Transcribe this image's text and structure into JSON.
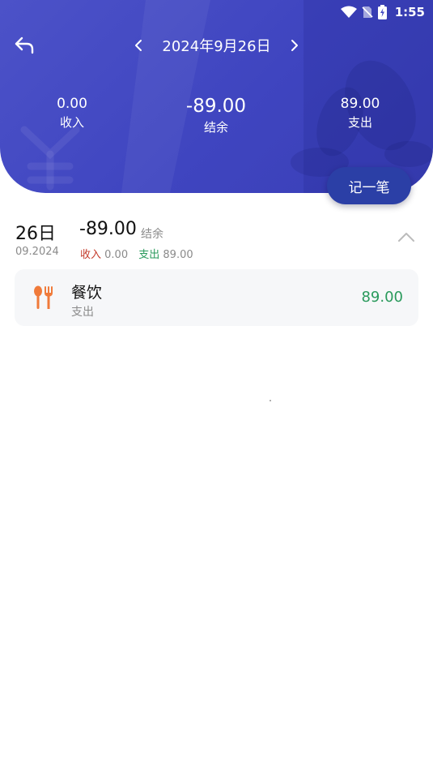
{
  "status_bar": {
    "time": "1:55"
  },
  "header": {
    "date_title": "2024年9月26日",
    "income": {
      "value": "0.00",
      "label": "收入"
    },
    "balance": {
      "value": "-89.00",
      "label": "结余"
    },
    "expense": {
      "value": "89.00",
      "label": "支出"
    },
    "record_button": "记一笔"
  },
  "day_group": {
    "day": "26日",
    "month": "09.2024",
    "balance": "-89.00",
    "balance_label": "结余",
    "income_label": "收入",
    "income_value": "0.00",
    "expense_label": "支出",
    "expense_value": "89.00"
  },
  "entries": [
    {
      "category": "餐饮",
      "type": "支出",
      "amount": "89.00",
      "icon": "utensils-icon"
    }
  ],
  "colors": {
    "header": "#4147c2",
    "record_button": "#2b3fa6",
    "income_red": "#c43b2b",
    "expense_green": "#2a9a5c",
    "category_orange": "#f07a3a"
  }
}
